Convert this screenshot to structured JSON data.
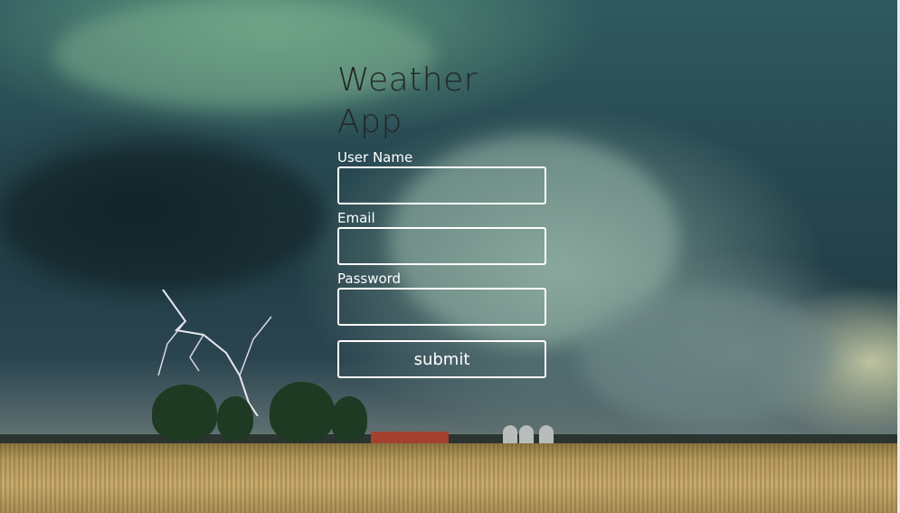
{
  "app": {
    "title": "Weather App"
  },
  "form": {
    "username_label": "User Name",
    "username_value": "",
    "email_label": "Email",
    "email_value": "",
    "password_label": "Password",
    "password_value": "",
    "submit_label": "submit"
  },
  "colors": {
    "title_text": "#222628",
    "label_text": "#ffffff",
    "input_border": "#ffffff"
  }
}
